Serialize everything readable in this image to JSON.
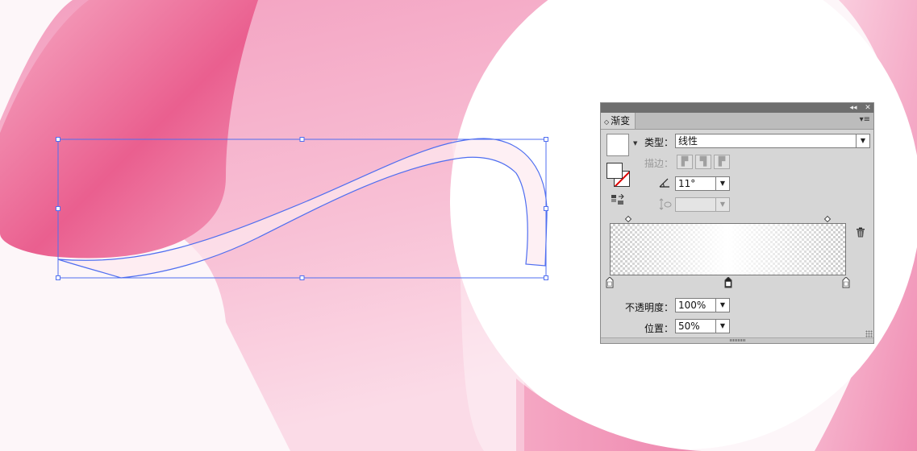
{
  "panel": {
    "tab_label": "渐变",
    "tab_arrows": "◇",
    "collapse_glyph": "◂◂",
    "close_glyph": "✕",
    "menu_glyph": "▾≡",
    "type_label": "类型：",
    "type_value": "线性",
    "stroke_label": "描边：",
    "angle_value": "11°",
    "aspect_value": "",
    "opacity_label": "不透明度：",
    "opacity_value": "100%",
    "location_label": "位置：",
    "location_value": "50%"
  },
  "gradient": {
    "midpoints_percent": [
      8,
      92
    ],
    "stops_percent": [
      0,
      50,
      100
    ],
    "selected_stop_percent": 50
  },
  "colors": {
    "artwork_pink_dark": "#e9578a",
    "artwork_pink_mid": "#f39ab9",
    "artwork_pink_light": "#f8c3d6",
    "selection_blue": "#4f6ef0",
    "panel_bg": "#d6d6d6"
  },
  "icons": {
    "angle": "angle-icon",
    "aspect": "aspect-ratio-icon",
    "trash": "trash-icon",
    "reverse": "reverse-gradient-icon"
  }
}
